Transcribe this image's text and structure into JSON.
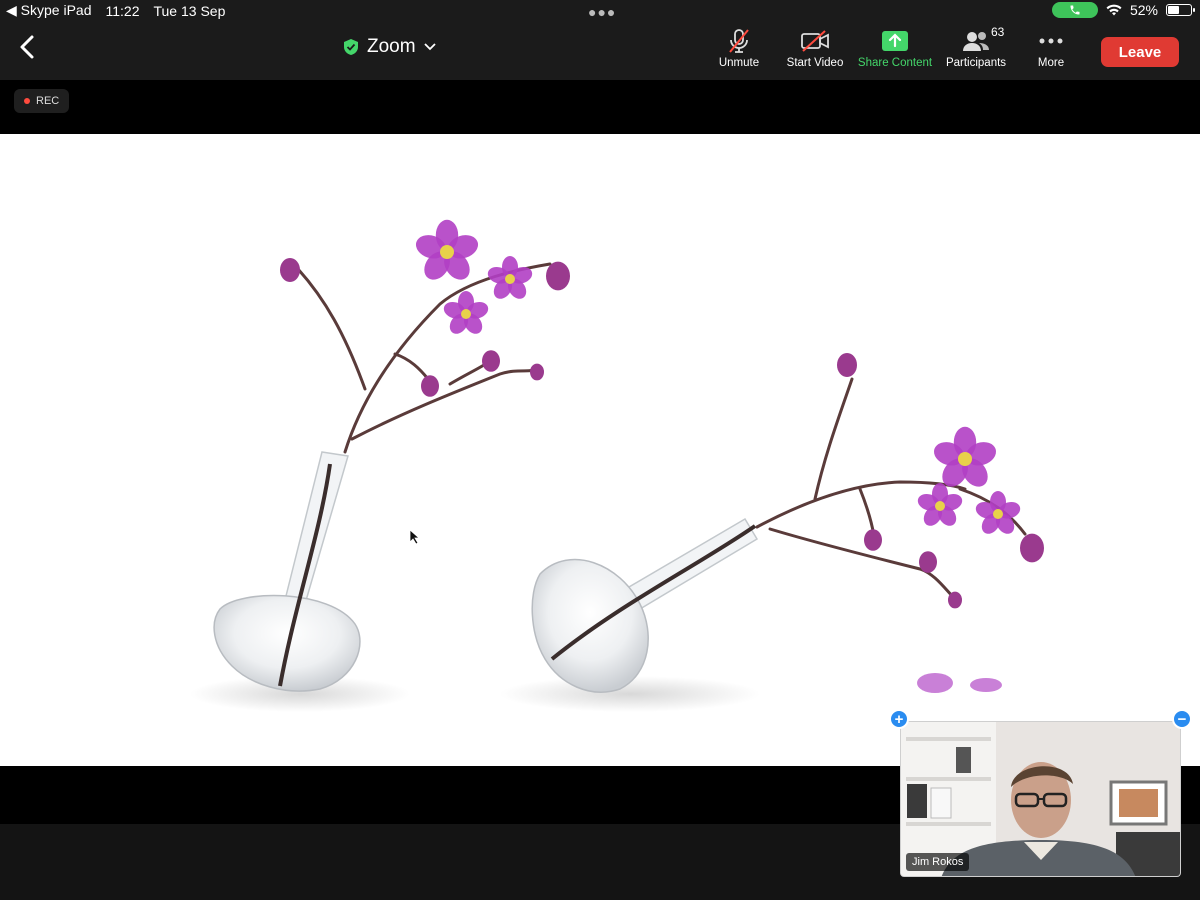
{
  "status_bar": {
    "back_app": "Skype iPad",
    "time": "11:22",
    "date": "Tue 13 Sep",
    "battery": "52%",
    "battery_level": 0.52
  },
  "meeting": {
    "title": "Zoom",
    "rec_label": "REC"
  },
  "toolbar": {
    "unmute_label": "Unmute",
    "start_video_label": "Start Video",
    "share_content_label": "Share Content",
    "participants_label": "Participants",
    "participants_count": "63",
    "more_label": "More",
    "leave_label": "Leave"
  },
  "self_view": {
    "name": "Jim Rokos"
  },
  "colors": {
    "accent_green": "#44d66a",
    "leave_red": "#e03a33",
    "pin_blue": "#2a8cf0",
    "orchid": "#b13fc4"
  }
}
